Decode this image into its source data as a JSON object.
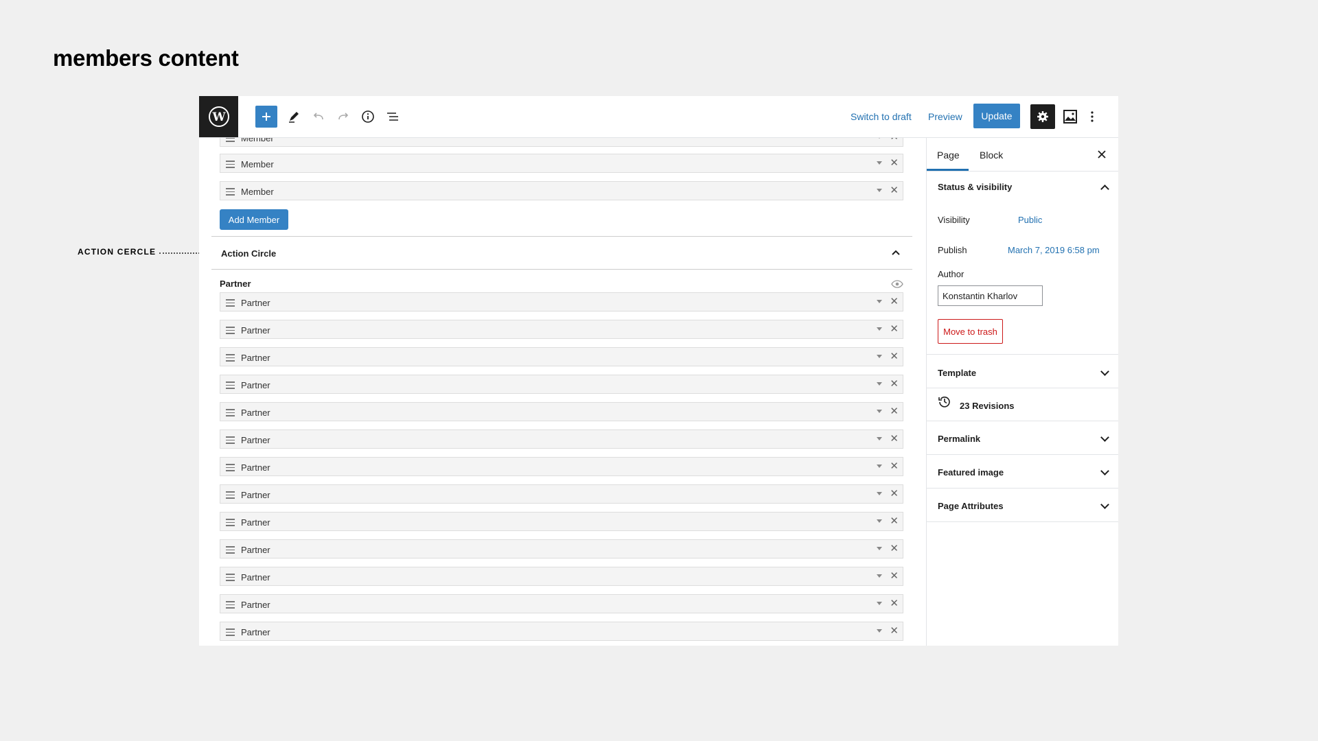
{
  "slide": {
    "title": "members content",
    "annotation": "ACTION CERCLE"
  },
  "toolbar": {
    "switch_to_draft": "Switch to draft",
    "preview": "Preview",
    "update": "Update"
  },
  "members": {
    "partial_row_label": "Member",
    "rows": [
      "Member",
      "Member"
    ],
    "add_button": "Add Member"
  },
  "action_circle": {
    "title": "Action Circle",
    "partner_heading": "Partner",
    "rows": [
      "Partner",
      "Partner",
      "Partner",
      "Partner",
      "Partner",
      "Partner",
      "Partner",
      "Partner",
      "Partner",
      "Partner",
      "Partner",
      "Partner",
      "Partner"
    ]
  },
  "sidebar": {
    "tabs": [
      "Page",
      "Block"
    ],
    "status_visibility": {
      "title": "Status & visibility",
      "visibility_label": "Visibility",
      "visibility_value": "Public",
      "publish_label": "Publish",
      "publish_value": "March 7, 2019 6:58 pm",
      "author_label": "Author",
      "author_value": "Konstantin Kharlov",
      "trash_button": "Move to trash"
    },
    "template": "Template",
    "revisions": "23 Revisions",
    "permalink": "Permalink",
    "featured_image": "Featured image",
    "page_attributes": "Page Attributes"
  },
  "colors": {
    "accent": "#3582c4",
    "link": "#2271b1",
    "danger": "#cc1818"
  }
}
